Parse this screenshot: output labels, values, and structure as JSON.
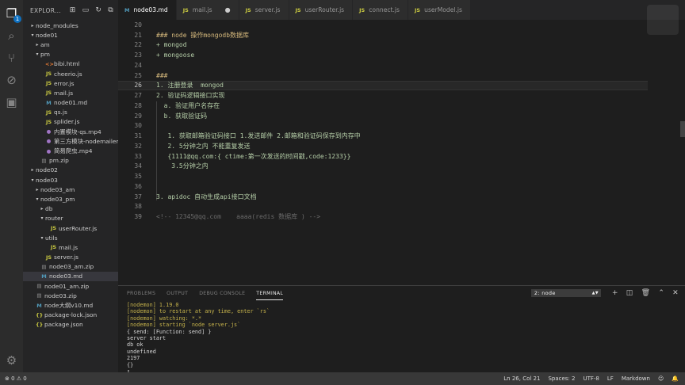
{
  "activity_bar": {
    "explorer_badge": "1"
  },
  "sidebar": {
    "title": "EXPLOR...",
    "items": [
      {
        "label": "node_modules",
        "depth": 0,
        "twisty": "▸",
        "icon": "",
        "color": "",
        "selected": false
      },
      {
        "label": "node01",
        "depth": 0,
        "twisty": "▾",
        "icon": "",
        "color": "",
        "selected": false
      },
      {
        "label": "am",
        "depth": 1,
        "twisty": "▸",
        "icon": "",
        "color": "",
        "selected": false
      },
      {
        "label": "pm",
        "depth": 1,
        "twisty": "▾",
        "icon": "",
        "color": "",
        "selected": false
      },
      {
        "label": "bibi.html",
        "depth": 2,
        "twisty": "",
        "icon": "<>",
        "color": "#e37933",
        "selected": false
      },
      {
        "label": "cheerio.js",
        "depth": 2,
        "twisty": "",
        "icon": "JS",
        "color": "#cbcb41",
        "selected": false
      },
      {
        "label": "error.js",
        "depth": 2,
        "twisty": "",
        "icon": "JS",
        "color": "#cbcb41",
        "selected": false
      },
      {
        "label": "mail.js",
        "depth": 2,
        "twisty": "",
        "icon": "JS",
        "color": "#cbcb41",
        "selected": false
      },
      {
        "label": "node01.md",
        "depth": 2,
        "twisty": "",
        "icon": "M",
        "color": "#519aba",
        "selected": false
      },
      {
        "label": "qs.js",
        "depth": 2,
        "twisty": "",
        "icon": "JS",
        "color": "#cbcb41",
        "selected": false
      },
      {
        "label": "splider.js",
        "depth": 2,
        "twisty": "",
        "icon": "JS",
        "color": "#cbcb41",
        "selected": false
      },
      {
        "label": "内置模块-qs.mp4",
        "depth": 2,
        "twisty": "",
        "icon": "●",
        "color": "#a074c4",
        "selected": false
      },
      {
        "label": "第三方模块-nodemailer...",
        "depth": 2,
        "twisty": "",
        "icon": "●",
        "color": "#a074c4",
        "selected": false
      },
      {
        "label": "简易爬虫.mp4",
        "depth": 2,
        "twisty": "",
        "icon": "●",
        "color": "#a074c4",
        "selected": false
      },
      {
        "label": "pm.zip",
        "depth": 1,
        "twisty": "",
        "icon": "▤",
        "color": "#8f8f8f",
        "selected": false
      },
      {
        "label": "node02",
        "depth": 0,
        "twisty": "▸",
        "icon": "",
        "color": "",
        "selected": false
      },
      {
        "label": "node03",
        "depth": 0,
        "twisty": "▾",
        "icon": "",
        "color": "",
        "selected": false
      },
      {
        "label": "node03_am",
        "depth": 1,
        "twisty": "▸",
        "icon": "",
        "color": "",
        "selected": false
      },
      {
        "label": "node03_pm",
        "depth": 1,
        "twisty": "▾",
        "icon": "",
        "color": "",
        "selected": false
      },
      {
        "label": "db",
        "depth": 2,
        "twisty": "▸",
        "icon": "",
        "color": "",
        "selected": false
      },
      {
        "label": "router",
        "depth": 2,
        "twisty": "▾",
        "icon": "",
        "color": "",
        "selected": false
      },
      {
        "label": "userRouter.js",
        "depth": 3,
        "twisty": "",
        "icon": "JS",
        "color": "#cbcb41",
        "selected": false
      },
      {
        "label": "utils",
        "depth": 2,
        "twisty": "▾",
        "icon": "",
        "color": "",
        "selected": false
      },
      {
        "label": "mail.js",
        "depth": 3,
        "twisty": "",
        "icon": "JS",
        "color": "#cbcb41",
        "selected": false
      },
      {
        "label": "server.js",
        "depth": 2,
        "twisty": "",
        "icon": "JS",
        "color": "#cbcb41",
        "selected": false
      },
      {
        "label": "node03_am.zip",
        "depth": 1,
        "twisty": "",
        "icon": "▤",
        "color": "#8f8f8f",
        "selected": false
      },
      {
        "label": "node03.md",
        "depth": 1,
        "twisty": "",
        "icon": "M",
        "color": "#519aba",
        "selected": true
      },
      {
        "label": "node01_am.zip",
        "depth": 0,
        "twisty": "",
        "icon": "▤",
        "color": "#8f8f8f",
        "selected": false
      },
      {
        "label": "node03.zip",
        "depth": 0,
        "twisty": "",
        "icon": "▤",
        "color": "#8f8f8f",
        "selected": false
      },
      {
        "label": "node大纲v10.md",
        "depth": 0,
        "twisty": "",
        "icon": "M",
        "color": "#519aba",
        "selected": false
      },
      {
        "label": "package-lock.json",
        "depth": 0,
        "twisty": "",
        "icon": "{}",
        "color": "#cbcb41",
        "selected": false
      },
      {
        "label": "package.json",
        "depth": 0,
        "twisty": "",
        "icon": "{}",
        "color": "#cbcb41",
        "selected": false
      }
    ]
  },
  "tabs": [
    {
      "label": "node03.md",
      "icon": "M",
      "active": true,
      "dirty": false
    },
    {
      "label": "mail.js",
      "icon": "JS",
      "active": false,
      "dirty": true
    },
    {
      "label": "server.js",
      "icon": "JS",
      "active": false,
      "dirty": false
    },
    {
      "label": "userRouter.js",
      "icon": "JS",
      "active": false,
      "dirty": false
    },
    {
      "label": "connect.js",
      "icon": "JS",
      "active": false,
      "dirty": false
    },
    {
      "label": "userModel.js",
      "icon": "JS",
      "active": false,
      "dirty": false
    }
  ],
  "editor": {
    "current_line": 26,
    "lines": [
      {
        "n": "20",
        "text": "",
        "cls": "c-txt"
      },
      {
        "n": "21",
        "text": "### node 操作mongodb数据库",
        "cls": "c-head"
      },
      {
        "n": "22",
        "text": "+ mongod",
        "cls": "c-md"
      },
      {
        "n": "23",
        "text": "+ mongoose",
        "cls": "c-md"
      },
      {
        "n": "24",
        "text": "",
        "cls": "c-txt"
      },
      {
        "n": "25",
        "text": "###",
        "cls": "c-head"
      },
      {
        "n": "26",
        "text": "1. 注册登录  mongod",
        "cls": "c-md"
      },
      {
        "n": "27",
        "text": "2. 验证码逻辑接口实现",
        "cls": "c-md"
      },
      {
        "n": "28",
        "text": "  a. 验证用户名存在",
        "cls": "c-md"
      },
      {
        "n": "29",
        "text": "  b. 获取验证码",
        "cls": "c-md"
      },
      {
        "n": "30",
        "text": "",
        "cls": "c-txt"
      },
      {
        "n": "31",
        "text": "   1. 获取邮箱验证码接口 1.发送邮件 2.邮箱和验证码保存到内存中",
        "cls": "c-md"
      },
      {
        "n": "32",
        "text": "   2. 5分钟之内 不能重复发送",
        "cls": "c-md"
      },
      {
        "n": "33",
        "text": "   {1111@qq.com:{ ctime:第一次发送的时间戳,code:1233}}",
        "cls": "c-md"
      },
      {
        "n": "34",
        "text": "    3.5分钟之内",
        "cls": "c-md"
      },
      {
        "n": "35",
        "text": "",
        "cls": "c-txt"
      },
      {
        "n": "36",
        "text": "",
        "cls": "c-txt"
      },
      {
        "n": "37",
        "text": "3. apidoc 自动生成api接口文档",
        "cls": "c-md"
      },
      {
        "n": "38",
        "text": "",
        "cls": "c-txt"
      },
      {
        "n": "39",
        "text": "<!-- 12345@qq.com    aaaa(redis 数据库 ) -->",
        "cls": "c-com"
      }
    ]
  },
  "panel": {
    "tabs": [
      {
        "label": "PROBLEMS",
        "active": false
      },
      {
        "label": "OUTPUT",
        "active": false
      },
      {
        "label": "DEBUG CONSOLE",
        "active": false
      },
      {
        "label": "TERMINAL",
        "active": true
      }
    ],
    "terminal_select": "2: node",
    "terminal_lines": [
      {
        "text": "[nodemon] 1.19.0",
        "cls": "t-n"
      },
      {
        "text": "[nodemon] to restart at any time, enter `rs`",
        "cls": "t-n"
      },
      {
        "text": "[nodemon] watching: *.*",
        "cls": "t-n"
      },
      {
        "text": "[nodemon] starting `node server.js`",
        "cls": "t-n"
      },
      {
        "text": "{ send: [Function: send] }",
        "cls": "t-w"
      },
      {
        "text": "server start",
        "cls": "t-w"
      },
      {
        "text": "db ok",
        "cls": "t-w"
      },
      {
        "text": "undefined",
        "cls": "t-w"
      },
      {
        "text": "2197",
        "cls": "t-w"
      },
      {
        "text": "{}",
        "cls": "t-w"
      },
      {
        "text": "▯",
        "cls": "t-w"
      }
    ]
  },
  "statusbar": {
    "errors": "0",
    "warnings": "0",
    "position": "Ln 26, Col 21",
    "spaces": "Spaces: 2",
    "encoding": "UTF-8",
    "eol": "LF",
    "language": "Markdown"
  }
}
